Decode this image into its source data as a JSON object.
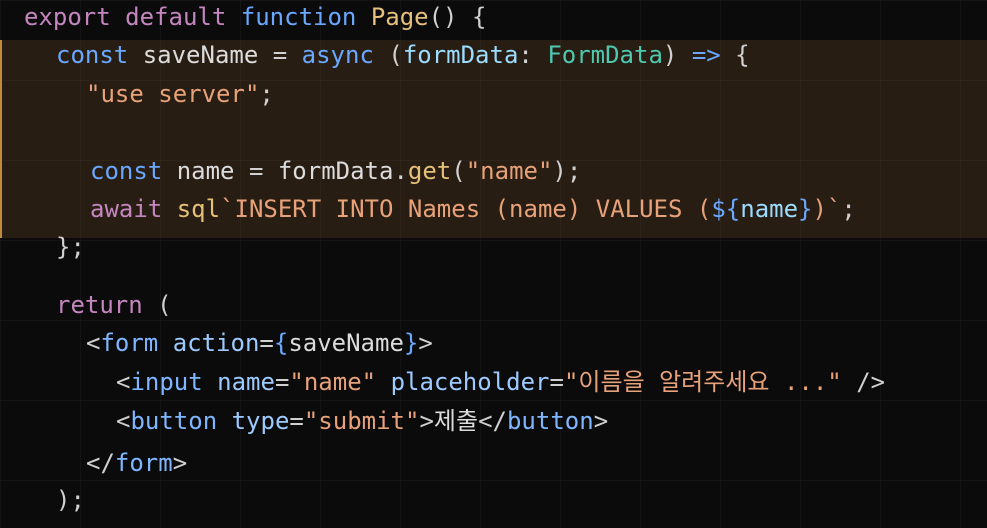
{
  "code": {
    "line1": {
      "kw_export": "export",
      "kw_default": "default",
      "kw_function": "function",
      "fn_name": "Page",
      "rest": "() {"
    },
    "line2": {
      "kw_const": "const",
      "name": "saveName",
      "eq": "=",
      "kw_async": "async",
      "open": "(",
      "param": "formData",
      "colon": ":",
      "type": "FormData",
      "close": ")",
      "arrow": "=>",
      "brace": "{"
    },
    "line3": {
      "directive": "\"use server\"",
      "semi": ";"
    },
    "line5": {
      "kw_const": "const",
      "name": "name",
      "eq": "=",
      "obj": "formData",
      "dot": ".",
      "method": "get",
      "open": "(",
      "arg": "\"name\"",
      "close": ");"
    },
    "line6": {
      "kw_await": "await",
      "tag": "sql",
      "tpl_start": "`INSERT INTO Names (name) VALUES (",
      "interp_open": "${",
      "interp_var": "name",
      "interp_close": "}",
      "tpl_end": ")`",
      "semi": ";"
    },
    "line7": {
      "text": "};"
    },
    "line9": {
      "kw_return": "return",
      "open": "("
    },
    "line10": {
      "lt": "<",
      "tag": "form",
      "attr": "action",
      "eq": "=",
      "jsx_open": "{",
      "value": "saveName",
      "jsx_close": "}",
      "gt": ">"
    },
    "line11": {
      "lt": "<",
      "tag": "input",
      "attr1": "name",
      "eq1": "=",
      "val1": "\"name\"",
      "attr2": "placeholder",
      "eq2": "=",
      "val2": "\"이름을 알려주세요 ...\"",
      "end": "/>"
    },
    "line12": {
      "lt": "<",
      "tag": "button",
      "attr": "type",
      "eq": "=",
      "val": "\"submit\"",
      "gt": ">",
      "text": "제출",
      "close_lt": "</",
      "close_tag": "button",
      "close_gt": ">"
    },
    "line13": {
      "close_lt": "</",
      "close_tag": "form",
      "close_gt": ">"
    },
    "line14": {
      "text": ");"
    }
  },
  "colors": {
    "background": "#0b0b0c",
    "highlight": "#3a2a1a",
    "keyword": "#c586c0",
    "string": "#e8a27a",
    "type": "#4ec9b0",
    "function": "#e5c07b"
  }
}
